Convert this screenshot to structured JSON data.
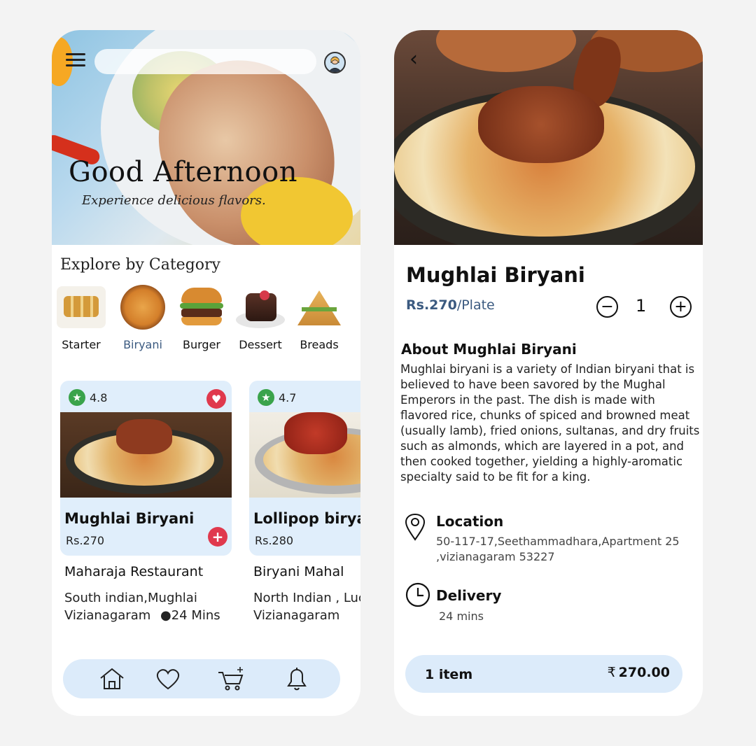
{
  "home": {
    "search_placeholder": "",
    "greeting": "Good Afternoon",
    "tagline": "Experience delicious flavors.",
    "section_title": "Explore by Category",
    "categories": [
      {
        "label": "Starter",
        "active": false
      },
      {
        "label": "Biryani",
        "active": true
      },
      {
        "label": "Burger",
        "active": false
      },
      {
        "label": "Dessert",
        "active": false
      },
      {
        "label": "Breads",
        "active": false
      }
    ],
    "cards": [
      {
        "rating": "4.8",
        "name": "Mughlai Biryani",
        "price": "Rs.270",
        "restaurant": "Maharaja Restaurant",
        "cuisine": "South indian,Mughlai",
        "city": "Vizianagaram",
        "time": "●24 Mins"
      },
      {
        "rating": "4.7",
        "name": "Lollipop biryani",
        "price": "Rs.280",
        "restaurant": "Biryani Mahal",
        "cuisine": "North Indian , Lucknowi",
        "city": "Vizianagaram"
      }
    ],
    "nav": [
      "home-icon",
      "heart-icon",
      "cart-add-icon",
      "bell-icon"
    ]
  },
  "detail": {
    "title": "Mughlai Biryani",
    "price": "Rs.270",
    "unit": "/Plate",
    "quantity": "1",
    "qty_minus": "−",
    "qty_plus": "+",
    "about_title": "About Mughlai Biryani",
    "about_text": "Mughlai biryani is a variety of Indian biryani that is believed to have been savored by the Mughal Emperors in the past. The dish is made with flavored rice, chunks of spiced and browned meat (usually lamb), fried onions, sultanas, and dry fruits such as almonds, which are layered in a pot, and then cooked together, yielding a highly-aromatic specialty said to be fit for a king.",
    "location_title": "Location",
    "location_text": "50-117-17,Seethammadhara,Apartment 25 ,vizianagaram 53227",
    "delivery_title": "Delivery",
    "delivery_text": "24 mins",
    "cart_items": "1 item",
    "cart_currency": "₹",
    "cart_total": "270.00"
  },
  "colors": {
    "accent_blue": "#3b5a80",
    "light_blue": "#dcebfa",
    "rating_green": "#3aa34b",
    "action_red": "#e0394d"
  }
}
